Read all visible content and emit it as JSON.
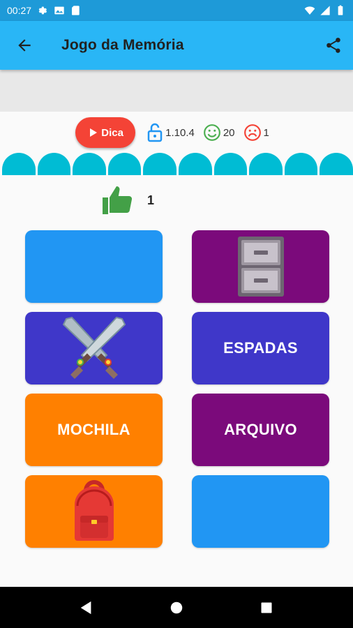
{
  "status_bar": {
    "time": "00:27"
  },
  "app_bar": {
    "title": "Jogo da Memória"
  },
  "toolbar": {
    "hint_label": "Dica",
    "version": "1.10.4",
    "correct_count": "20",
    "wrong_count": "1"
  },
  "progress": {
    "bump_count": 10
  },
  "score": {
    "value": "1"
  },
  "colors": {
    "app_bar": "#29b6f6",
    "status_bar": "#1e9ad8",
    "hint_button": "#f44336",
    "progress": "#00bcd4",
    "blue": "#2196f3",
    "purple": "#7b0a7b",
    "indigo": "#3f37c9",
    "orange": "#ff8000"
  },
  "cards": [
    {
      "id": "card-1",
      "face": "hidden",
      "color": "blue",
      "label": ""
    },
    {
      "id": "card-2",
      "face": "icon",
      "icon": "filing-cabinet-icon",
      "color": "purple",
      "label": ""
    },
    {
      "id": "card-3",
      "face": "icon",
      "icon": "crossed-swords-icon",
      "color": "indigo",
      "label": ""
    },
    {
      "id": "card-4",
      "face": "text",
      "color": "indigo",
      "label": "ESPADAS"
    },
    {
      "id": "card-5",
      "face": "text",
      "color": "orange",
      "label": "MOCHILA"
    },
    {
      "id": "card-6",
      "face": "text",
      "color": "purple",
      "label": "ARQUIVO"
    },
    {
      "id": "card-7",
      "face": "icon",
      "icon": "backpack-icon",
      "color": "orange",
      "label": ""
    },
    {
      "id": "card-8",
      "face": "hidden",
      "color": "blue",
      "label": ""
    }
  ]
}
